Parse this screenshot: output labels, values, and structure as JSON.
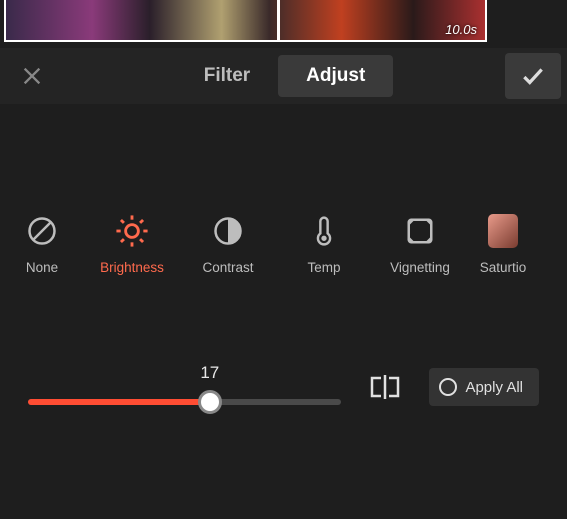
{
  "timeline": {
    "timecode": "10.0s"
  },
  "header": {
    "tabs": [
      {
        "label": "Filter",
        "active": false
      },
      {
        "label": "Adjust",
        "active": true
      }
    ]
  },
  "adjust": {
    "items": [
      {
        "key": "none",
        "label": "None",
        "icon": "ban-icon",
        "selected": false
      },
      {
        "key": "brightness",
        "label": "Brightness",
        "icon": "brightness-icon",
        "selected": true
      },
      {
        "key": "contrast",
        "label": "Contrast",
        "icon": "contrast-icon",
        "selected": false
      },
      {
        "key": "temp",
        "label": "Temp",
        "icon": "thermometer-icon",
        "selected": false
      },
      {
        "key": "vignetting",
        "label": "Vignetting",
        "icon": "vignette-icon",
        "selected": false
      },
      {
        "key": "saturation",
        "label": "Saturtio",
        "icon": "saturation-icon",
        "selected": false
      }
    ]
  },
  "slider": {
    "value": 17,
    "min": -50,
    "max": 50,
    "fill_percent": 58,
    "apply_all_label": "Apply All"
  },
  "colors": {
    "accent": "#ff4d33",
    "accent_soft": "#ff6a4d",
    "bg": "#1e1e1e",
    "panel": "#242424",
    "chip": "#3a3a3a",
    "text": "#e0e0e0",
    "text_muted": "#bdbdbd"
  }
}
